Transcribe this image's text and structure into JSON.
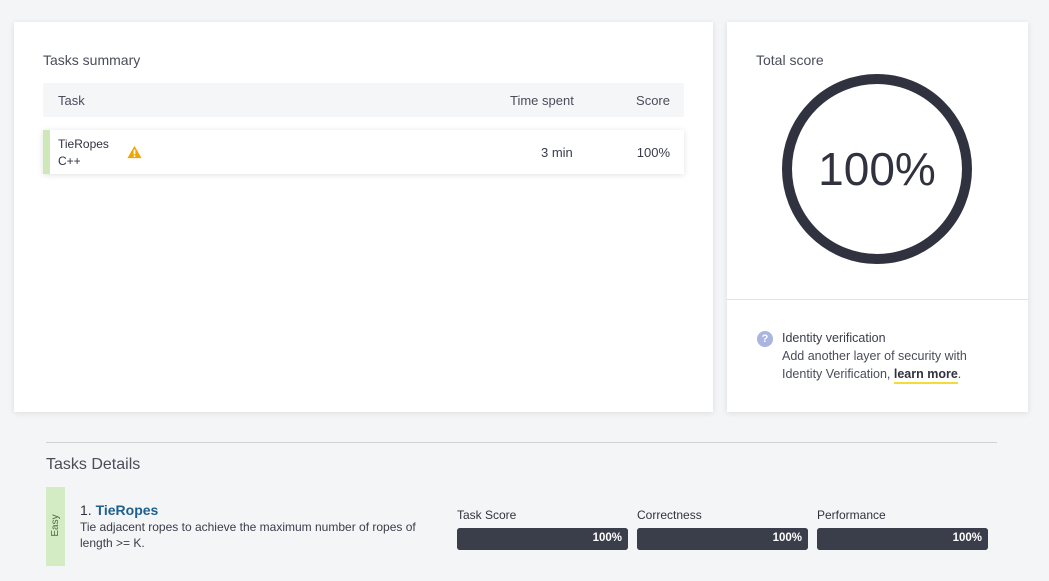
{
  "summary": {
    "title": "Tasks summary",
    "columns": {
      "task": "Task",
      "time": "Time spent",
      "score": "Score"
    },
    "rows": [
      {
        "name": "TieRopes",
        "language": "C++",
        "time": "3 min",
        "score": "100%",
        "warning_icon": "warning-icon"
      }
    ]
  },
  "total": {
    "title": "Total score",
    "score_text": "100%",
    "score_fraction": 1.0,
    "ring_color": "#30333f"
  },
  "identity": {
    "title": "Identity verification",
    "line1": "Add another layer of security with",
    "line2_prefix": "Identity Verification, ",
    "link": "learn more",
    "suffix": ".",
    "icon": "help-icon"
  },
  "details": {
    "title": "Tasks Details",
    "tasks": [
      {
        "difficulty": "Easy",
        "number": "1.",
        "name": "TieRopes",
        "description": "Tie adjacent ropes to achieve the maximum number of ropes of length >= K.",
        "metrics": [
          {
            "label": "Task Score",
            "value": "100%",
            "fraction": 1.0
          },
          {
            "label": "Correctness",
            "value": "100%",
            "fraction": 1.0
          },
          {
            "label": "Performance",
            "value": "100%",
            "fraction": 1.0
          }
        ]
      }
    ]
  },
  "colors": {
    "accent": "#30333f",
    "easy": "#d3ecc3",
    "link": "#1f5f8c",
    "warning": "#f0a500",
    "underline": "#f2dc3a"
  }
}
